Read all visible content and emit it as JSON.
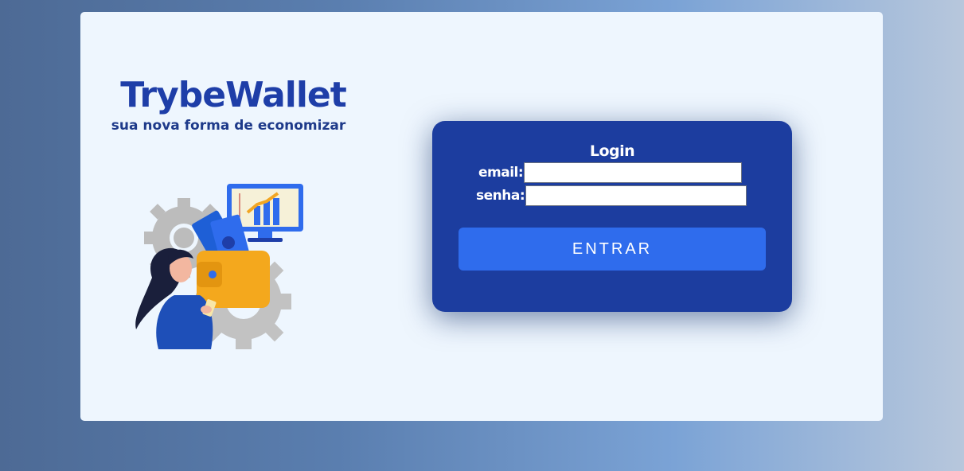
{
  "brand": {
    "title": "TrybeWallet",
    "subtitle": "sua nova forma de economizar"
  },
  "illustration": {
    "icon": "wallet-savings-illustration"
  },
  "login": {
    "title": "Login",
    "email_label": "email:",
    "email_value": "",
    "password_label": "senha:",
    "password_value": "",
    "submit_label": "ENTRAR"
  },
  "colors": {
    "card_background": "#eef6fe",
    "brand": "#1e3ea8",
    "login_box": "#1c3d9f",
    "button": "#2f6ced"
  }
}
